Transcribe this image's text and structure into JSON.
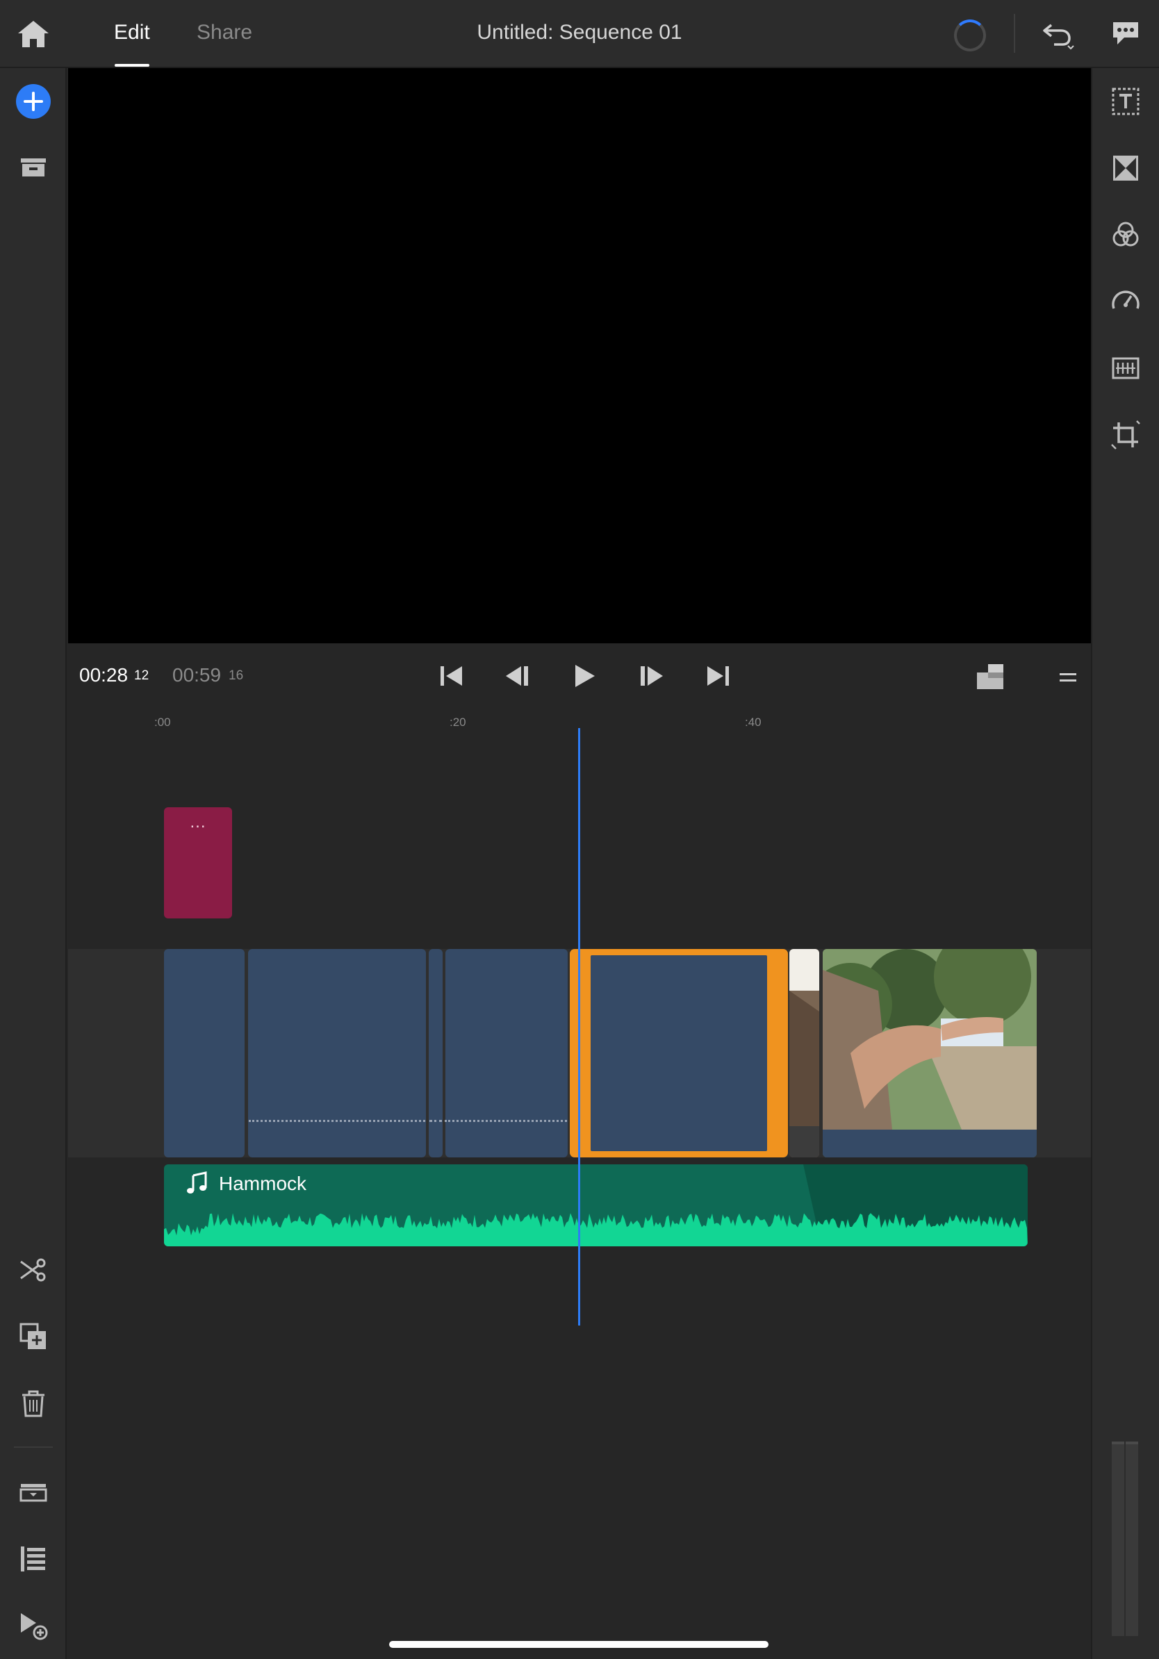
{
  "app": {
    "tabs": [
      {
        "label": "Edit",
        "active": true
      },
      {
        "label": "Share",
        "active": false
      }
    ],
    "sequence_title": "Untitled: Sequence 01"
  },
  "topbar_icons": [
    "home-icon",
    "loading-spinner-icon",
    "undo-icon",
    "feedback-icon"
  ],
  "left_rail": {
    "top_icons": [
      "add-media-icon",
      "project-bin-icon"
    ],
    "bottom_icons": [
      "split-scissors-icon",
      "duplicate-icon",
      "delete-trash-icon",
      "track-settings-icon",
      "tracks-list-icon",
      "add-track-icon"
    ]
  },
  "right_rail": {
    "icons": [
      "titles-icon",
      "transitions-icon",
      "color-icon",
      "speed-icon",
      "audio-adjust-icon",
      "crop-transform-icon"
    ]
  },
  "transport": {
    "current_time": "00:28",
    "current_frames": "12",
    "duration_time": "00:59",
    "duration_frames": "16",
    "buttons": [
      "go-to-start-icon",
      "step-back-icon",
      "play-icon",
      "step-forward-icon",
      "go-to-end-icon"
    ]
  },
  "timeline": {
    "ruler": [
      ":00",
      ":20",
      ":40"
    ],
    "title_clip_label": "...",
    "audio_clip_label": "Hammock",
    "accent_colors": {
      "playhead": "#2d7cf6",
      "selection": "#f0931f",
      "title_clip": "#8a1c45",
      "audio_clip": "#0e6a55",
      "audio_wave": "#12d694",
      "video_clip": "#354a66"
    }
  }
}
